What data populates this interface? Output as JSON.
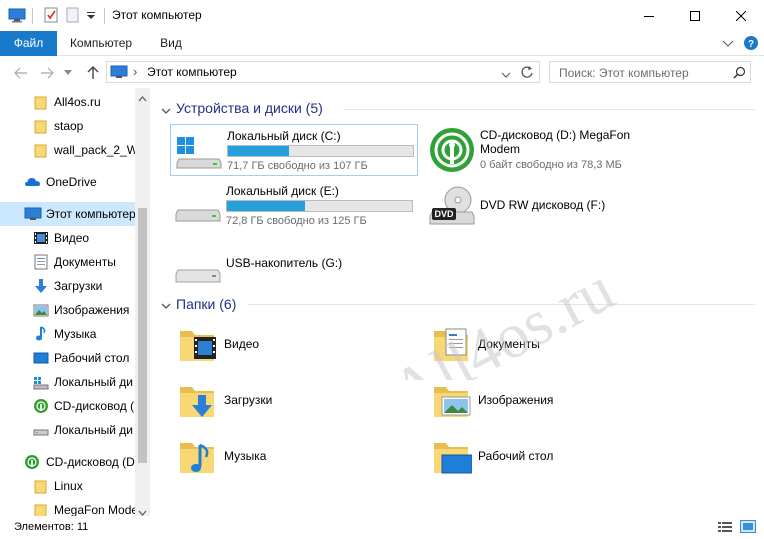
{
  "window": {
    "title": "Этот компьютер"
  },
  "ribbon": {
    "tabs": [
      "Файл",
      "Компьютер",
      "Вид"
    ],
    "active_color": "#1979ca"
  },
  "address": {
    "path": "Этот компьютер",
    "separator": "›"
  },
  "search": {
    "placeholder": "Поиск: Этот компьютер"
  },
  "nav": {
    "items": [
      {
        "label": "All4os.ru",
        "icon": "folder-icon"
      },
      {
        "label": "staop",
        "icon": "folder-icon"
      },
      {
        "label": "wall_pack_2_Wi",
        "icon": "folder-icon"
      },
      {
        "label": "OneDrive",
        "icon": "onedrive-icon"
      },
      {
        "label": "Этот компьютер",
        "icon": "computer-icon"
      },
      {
        "label": "Видео",
        "icon": "video-icon"
      },
      {
        "label": "Документы",
        "icon": "documents-icon"
      },
      {
        "label": "Загрузки",
        "icon": "downloads-icon"
      },
      {
        "label": "Изображения",
        "icon": "pictures-icon"
      },
      {
        "label": "Музыка",
        "icon": "music-icon"
      },
      {
        "label": "Рабочий стол",
        "icon": "desktop-icon"
      },
      {
        "label": "Локальный ди",
        "icon": "local-disk-icon"
      },
      {
        "label": "CD-дисковод (",
        "icon": "megafon-icon"
      },
      {
        "label": "Локальный ди",
        "icon": "local-disk-icon"
      },
      {
        "label": "CD-дисковод (D",
        "icon": "megafon-icon"
      },
      {
        "label": "Linux",
        "icon": "folder-icon"
      },
      {
        "label": "MegaFon Mode",
        "icon": "folder-icon"
      }
    ]
  },
  "devices": {
    "header": "Устройства и диски (5)",
    "items": [
      {
        "name": "Локальный диск (C:)",
        "free": "71,7 ГБ свободно из 107 ГБ",
        "used_fraction": 0.33,
        "icon": "windows-drive-icon"
      },
      {
        "name_line1": "CD-дисковод (D:) MegaFon",
        "name_line2": "Modem",
        "free": "0 байт свободно из 78,3 МБ",
        "icon": "megafon-modem-icon"
      },
      {
        "name": "Локальный диск (E:)",
        "free": "72,8 ГБ свободно из 125 ГБ",
        "used_fraction": 0.42,
        "icon": "hard-drive-icon"
      },
      {
        "name": "DVD RW дисковод (F:)",
        "icon": "dvd-drive-icon"
      },
      {
        "name": "USB-накопитель (G:)",
        "icon": "usb-drive-icon"
      }
    ]
  },
  "folders": {
    "header": "Папки (6)",
    "items": [
      {
        "name": "Видео",
        "icon": "video-folder-icon"
      },
      {
        "name": "Документы",
        "icon": "documents-folder-icon"
      },
      {
        "name": "Загрузки",
        "icon": "downloads-folder-icon"
      },
      {
        "name": "Изображения",
        "icon": "pictures-folder-icon"
      },
      {
        "name": "Музыка",
        "icon": "music-folder-icon"
      },
      {
        "name": "Рабочий стол",
        "icon": "desktop-folder-icon"
      }
    ]
  },
  "watermark": "All4os.ru",
  "status": {
    "count": "Элементов: 11"
  }
}
